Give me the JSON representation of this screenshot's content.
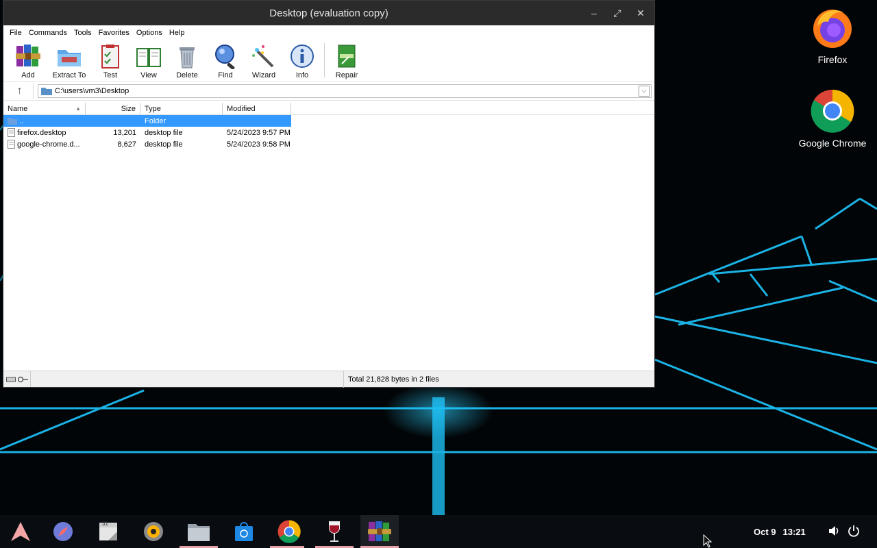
{
  "window": {
    "title": "Desktop (evaluation copy)",
    "controls": {
      "minimize": "–",
      "maximize": "⤢",
      "close": "✕"
    }
  },
  "menu": [
    "File",
    "Commands",
    "Tools",
    "Favorites",
    "Options",
    "Help"
  ],
  "toolbar": [
    {
      "label": "Add",
      "icon": "winrar-books-icon"
    },
    {
      "label": "Extract To",
      "icon": "folder-extract-icon"
    },
    {
      "label": "Test",
      "icon": "clipboard-check-icon"
    },
    {
      "label": "View",
      "icon": "open-book-icon"
    },
    {
      "label": "Delete",
      "icon": "trash-can-icon"
    },
    {
      "label": "Find",
      "icon": "magnifier-icon"
    },
    {
      "label": "Wizard",
      "icon": "magic-wand-icon"
    },
    {
      "label": "Info",
      "icon": "info-icon"
    },
    {
      "label": "Repair",
      "icon": "repair-box-icon"
    }
  ],
  "address": {
    "path": "C:\\users\\vm3\\Desktop"
  },
  "columns": [
    "Name",
    "Size",
    "Type",
    "Modified"
  ],
  "files": [
    {
      "name": "..",
      "size": "",
      "type": "Folder",
      "modified": "",
      "selected": true
    },
    {
      "name": "firefox.desktop",
      "size": "13,201",
      "type": "desktop file",
      "modified": "5/24/2023 9:57 PM"
    },
    {
      "name": "google-chrome.d...",
      "size": "8,627",
      "type": "desktop file",
      "modified": "5/24/2023 9:58 PM"
    }
  ],
  "status": {
    "text": "Total 21,828 bytes in 2 files"
  },
  "desktop_icons": [
    {
      "label": "Firefox",
      "icon": "firefox-icon"
    },
    {
      "label": "Google Chrome",
      "icon": "chrome-icon"
    }
  ],
  "taskbar": {
    "apps": [
      "arch-launcher-icon",
      "compass-browser-icon",
      "calendar-icon",
      "speaker-app-icon",
      "files-icon",
      "store-icon",
      "chrome-icon",
      "wine-icon",
      "winrar-icon"
    ],
    "calendar_day": "31",
    "date": "Oct 9",
    "time": "13:21"
  },
  "colors": {
    "selection": "#3399ff",
    "titlebar": "#2b2b2b",
    "neon": "#1fc8ff"
  }
}
